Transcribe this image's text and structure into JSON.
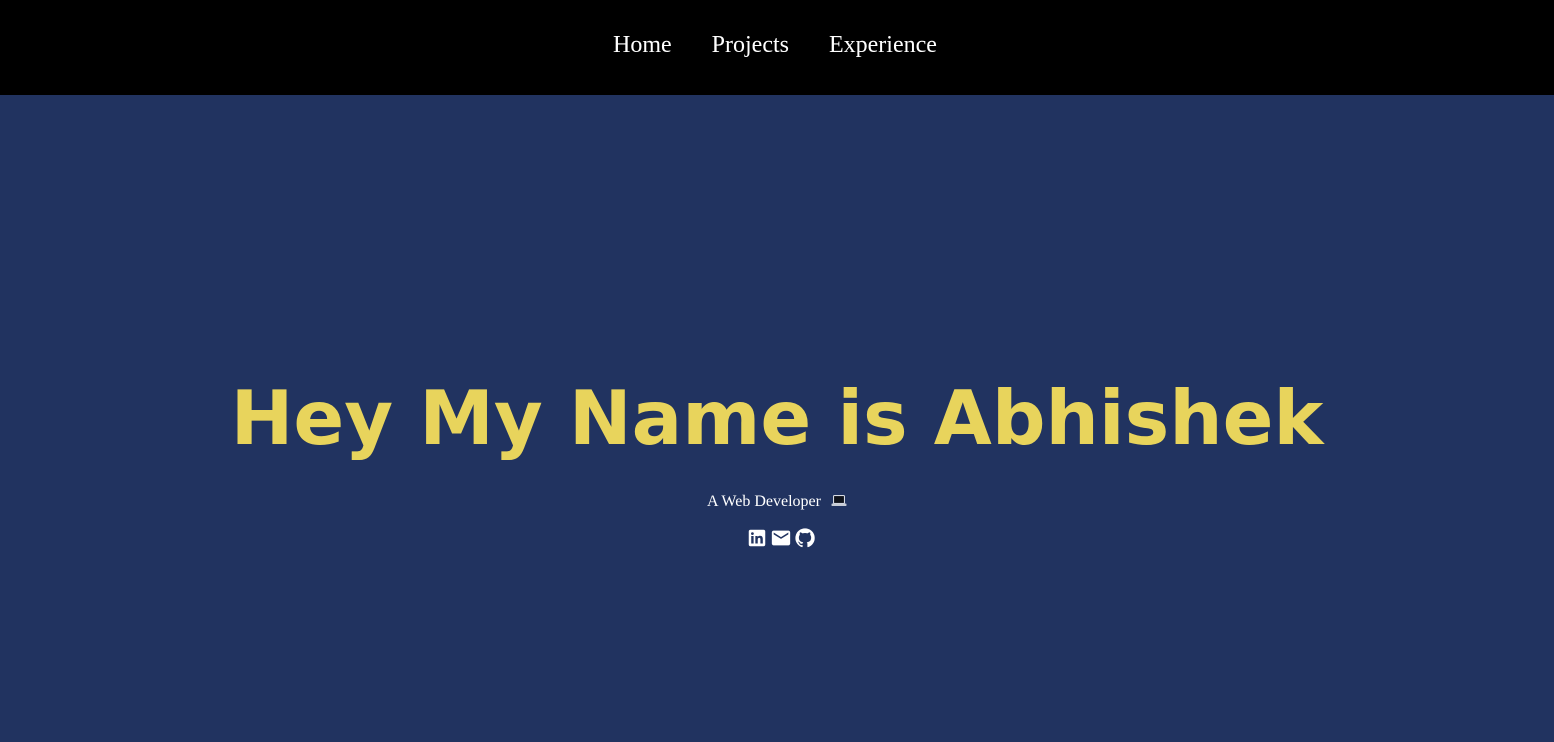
{
  "nav": {
    "items": [
      {
        "label": "Home"
      },
      {
        "label": "Projects"
      },
      {
        "label": "Experience"
      }
    ]
  },
  "hero": {
    "title": "Hey My Name is Abhishek",
    "subtitle": "A Web Developer",
    "subtitle_icon": "laptop-icon",
    "social": [
      {
        "icon": "linkedin-icon"
      },
      {
        "icon": "email-icon"
      },
      {
        "icon": "github-icon"
      }
    ]
  },
  "colors": {
    "navbar_bg": "#000000",
    "hero_bg": "#213360",
    "title": "#e8d45c",
    "text": "#ffffff"
  }
}
